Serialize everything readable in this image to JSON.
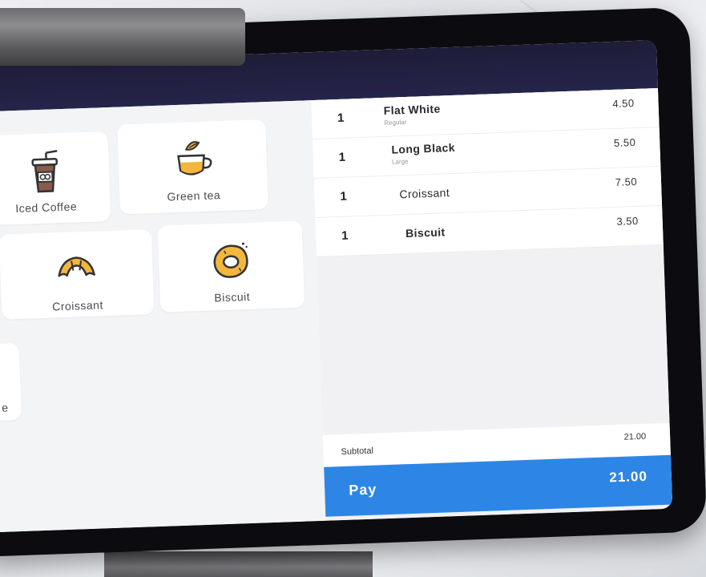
{
  "products": [
    {
      "label": "Iced Coffee",
      "icon": "iced-coffee-icon"
    },
    {
      "label": "Green tea",
      "icon": "green-tea-icon"
    },
    {
      "label": "Croissant",
      "icon": "croissant-icon"
    },
    {
      "label": "Biscuit",
      "icon": "biscuit-icon"
    },
    {
      "label": "e",
      "icon": ""
    }
  ],
  "order": {
    "items": [
      {
        "qty": "1",
        "name": "Flat White",
        "modifier": "Regular",
        "price": "4.50"
      },
      {
        "qty": "1",
        "name": "Long Black",
        "modifier": "Large",
        "price": "5.50"
      },
      {
        "qty": "1",
        "name": "Croissant",
        "modifier": "",
        "price": "7.50"
      },
      {
        "qty": "1",
        "name": "Biscuit",
        "modifier": "",
        "price": "3.50"
      }
    ],
    "subtotal_label": "Subtotal",
    "subtotal_value": "21.00",
    "pay_label": "Pay",
    "pay_amount": "21.00"
  },
  "colors": {
    "accent": "#2d86e6",
    "header": "#1d1d38",
    "icon_fill": "#f2b73c"
  }
}
